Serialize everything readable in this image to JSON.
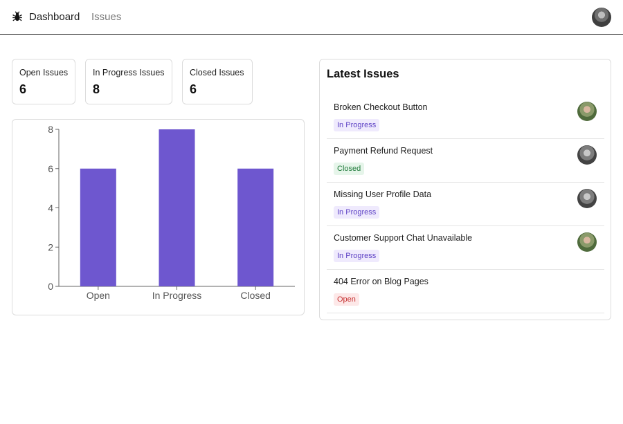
{
  "nav": {
    "logo_icon": "bug-icon",
    "links": [
      {
        "label": "Dashboard",
        "active": true
      },
      {
        "label": "Issues",
        "active": false
      }
    ],
    "avatar_icon": "user-avatar"
  },
  "stats": [
    {
      "label": "Open Issues",
      "value": "6"
    },
    {
      "label": "In Progress Issues",
      "value": "8"
    },
    {
      "label": "Closed Issues",
      "value": "6"
    }
  ],
  "chart_data": {
    "type": "bar",
    "categories": [
      "Open",
      "In Progress",
      "Closed"
    ],
    "values": [
      6,
      8,
      6
    ],
    "title": "",
    "xlabel": "",
    "ylabel": "",
    "ylim": [
      0,
      8
    ],
    "yticks": [
      0,
      2,
      4,
      6,
      8
    ],
    "grid": false,
    "bar_color": "#6e57cf"
  },
  "latest": {
    "title": "Latest Issues",
    "issues": [
      {
        "title": "Broken Checkout Button",
        "status": "In Progress",
        "status_key": "progress",
        "has_assignee": true,
        "avatar": "green"
      },
      {
        "title": "Payment Refund Request",
        "status": "Closed",
        "status_key": "closed",
        "has_assignee": true,
        "avatar": "gray"
      },
      {
        "title": "Missing User Profile Data",
        "status": "In Progress",
        "status_key": "progress",
        "has_assignee": true,
        "avatar": "gray"
      },
      {
        "title": "Customer Support Chat Unavailable",
        "status": "In Progress",
        "status_key": "progress",
        "has_assignee": true,
        "avatar": "green"
      },
      {
        "title": "404 Error on Blog Pages",
        "status": "Open",
        "status_key": "open",
        "has_assignee": false,
        "avatar": ""
      }
    ]
  }
}
